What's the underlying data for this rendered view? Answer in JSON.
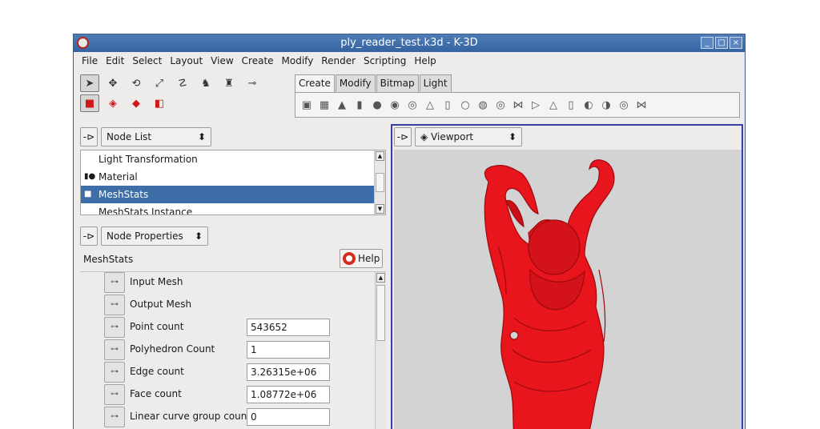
{
  "window": {
    "title": "ply_reader_test.k3d - K-3D",
    "btn_min": "_",
    "btn_max": "□",
    "btn_close": "×"
  },
  "menu": [
    "File",
    "Edit",
    "Select",
    "Layout",
    "View",
    "Create",
    "Modify",
    "Render",
    "Scripting",
    "Help"
  ],
  "toolbar": {
    "tools_row1": [
      "select-arrow-icon",
      "move-icon",
      "rotate-icon",
      "scale-icon",
      "path-icon",
      "figures-icon",
      "figure-icon",
      "plug-icon",
      "panel-icon",
      "clapper-icon"
    ],
    "tabs": [
      "Create",
      "Modify",
      "Bitmap",
      "Light"
    ],
    "active_tab": "Create"
  },
  "node_list": {
    "pin_label": "-⊳",
    "combo_label": "Node List",
    "items": [
      {
        "label": "Light Transformation",
        "selected": false
      },
      {
        "label": "Material",
        "selected": false
      },
      {
        "label": "MeshStats",
        "selected": true
      },
      {
        "label": "MeshStats Instance",
        "selected": false
      }
    ]
  },
  "node_properties": {
    "combo_label": "Node Properties",
    "node_name": "MeshStats",
    "help_label": "Help",
    "rows": [
      {
        "label": "Input Mesh",
        "value": null
      },
      {
        "label": "Output Mesh",
        "value": null
      },
      {
        "label": "Point count",
        "value": "543652"
      },
      {
        "label": "Polyhedron Count",
        "value": "1"
      },
      {
        "label": "Edge count",
        "value": "3.26315e+06"
      },
      {
        "label": "Face count",
        "value": "1.08772e+06"
      },
      {
        "label": "Linear curve group count",
        "value": "0"
      }
    ]
  },
  "viewport": {
    "combo_label": "Viewport",
    "bg_color": "#d3d3d3",
    "model_color": "#e8151c"
  }
}
